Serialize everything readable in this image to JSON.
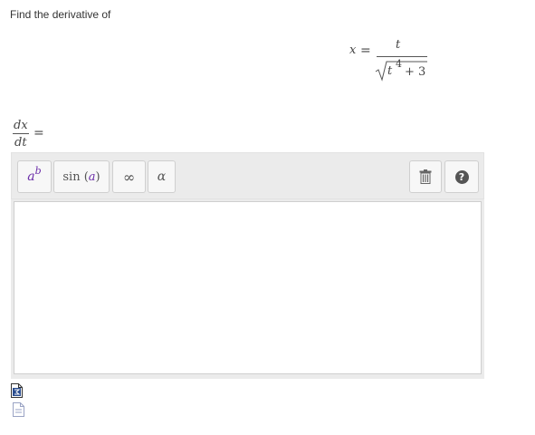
{
  "prompt": {
    "text": "Find the derivative of"
  },
  "equation": {
    "variable": "x",
    "equals": "=",
    "numerator": "t",
    "radicand_base": "t",
    "radicand_exponent": "4",
    "radicand_plus": "+",
    "radicand_constant": "3"
  },
  "answer_lhs": {
    "numerator": "dx",
    "denominator": "dt",
    "equals": "="
  },
  "toolbar": {
    "exponent_base": "a",
    "exponent_power": "b",
    "function_prefix": "sin (",
    "function_arg": "a",
    "function_suffix": ")",
    "infinity_symbol": "∞",
    "greek_symbol": "α",
    "help_symbol": "?"
  },
  "answer_input": {
    "value": ""
  },
  "icons": {
    "toolbar_exponent": "exponent-icon",
    "toolbar_function": "function-icon",
    "toolbar_infinity": "infinity-icon",
    "toolbar_greek": "greek-alpha-icon",
    "toolbar_delete": "trash-icon",
    "toolbar_help": "help-icon",
    "bottom_first": "math-document-icon",
    "bottom_second": "document-icon"
  }
}
